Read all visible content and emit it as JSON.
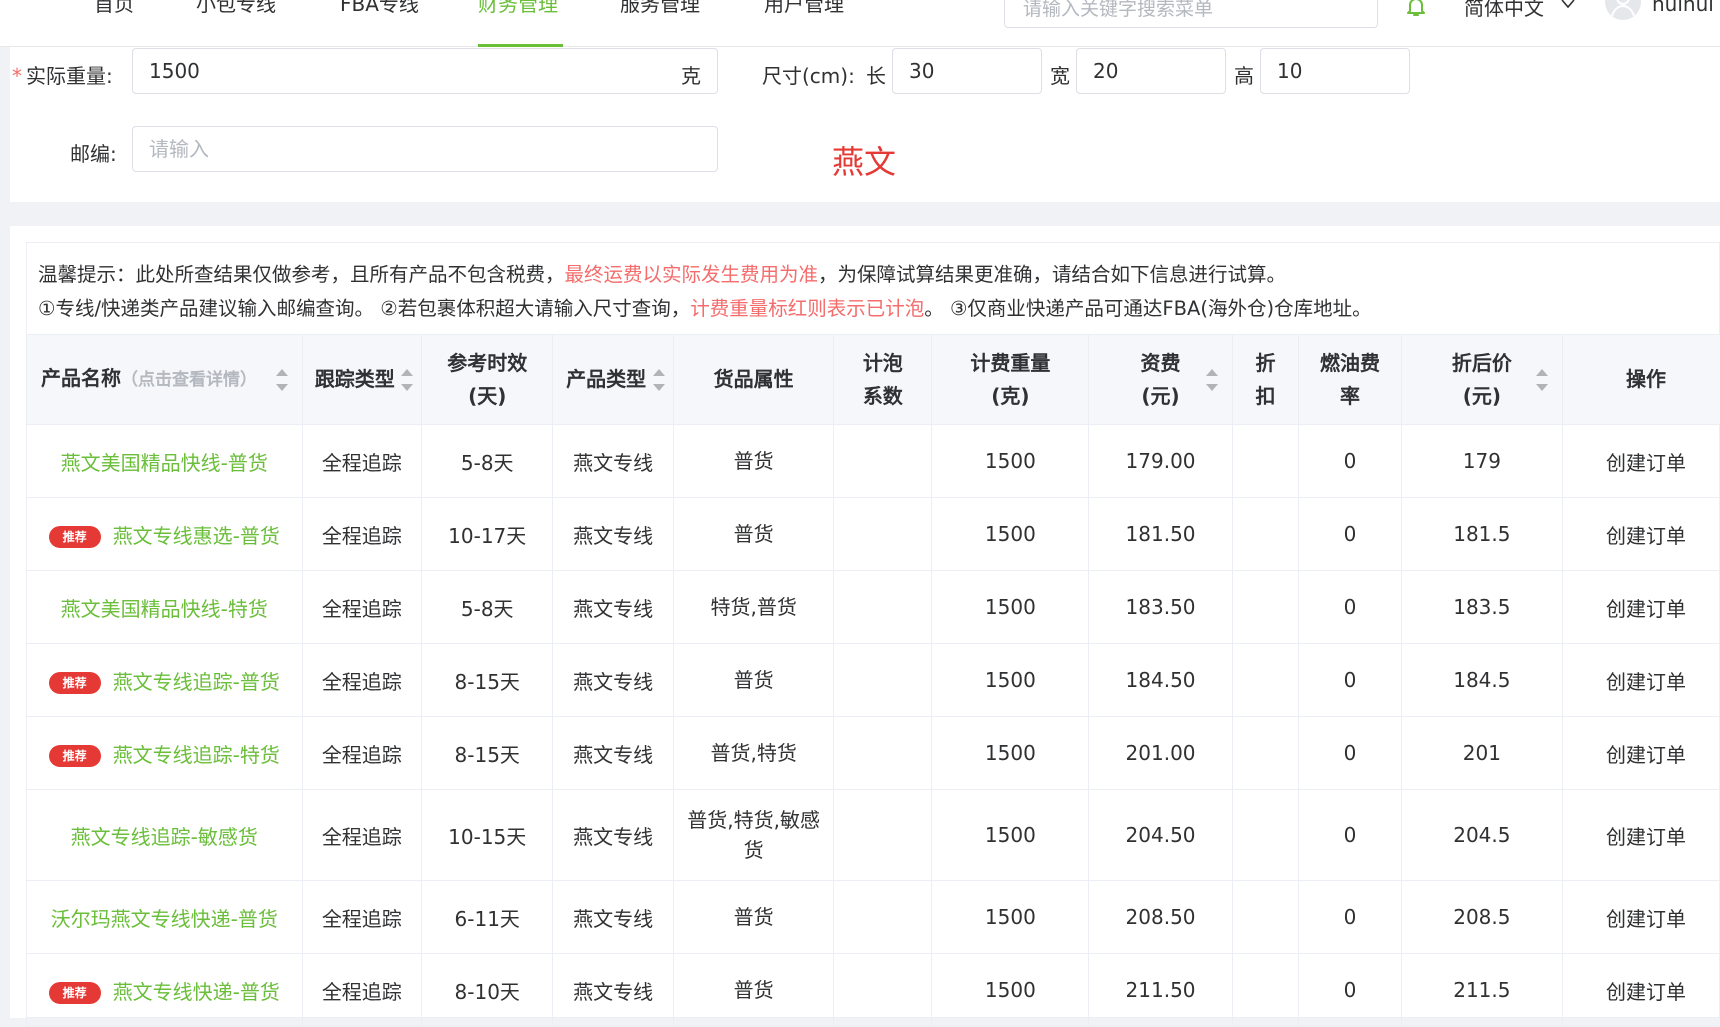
{
  "nav": {
    "items": [
      {
        "label": "首页",
        "active": false
      },
      {
        "label": "小包专线",
        "active": false
      },
      {
        "label": "FBA专线",
        "active": false
      },
      {
        "label": "财务管理",
        "active": true
      },
      {
        "label": "服务管理",
        "active": false
      },
      {
        "label": "用户管理",
        "active": false
      }
    ],
    "search_placeholder": "请输入关键字搜索菜单",
    "language": "简体中文",
    "username": "huihui"
  },
  "form": {
    "weight_label": "实际重量:",
    "weight_required_mark": "*",
    "weight_value": "1500",
    "weight_unit": "克",
    "size_label": "尺寸(cm):",
    "length_label": "长",
    "length_value": "30",
    "width_label": "宽",
    "width_value": "20",
    "height_label": "高",
    "height_value": "10",
    "zip_label": "邮编:",
    "zip_placeholder": "请输入",
    "carrier_name": "燕文"
  },
  "tips": {
    "line1_a": "温馨提示：此处所查结果仅做参考，且所有产品不包含税费，",
    "line1_b": "最终运费以实际发生费用为准",
    "line1_c": "，为保障试算结果更准确，请结合如下信息进行试算。",
    "line2_a": "①专线/快递类产品建议输入邮编查询。 ②若包裹体积超大请输入尺寸查询，",
    "line2_b": "计费重量标红则表示已计泡",
    "line2_c": "。 ③仅商业快递产品可通达FBA(海外仓)仓库地址。"
  },
  "table": {
    "headers": {
      "product_name": "产品名称",
      "product_hint": "（点击查看详情）",
      "tracking_type": "跟踪类型",
      "eta": "参考时效(天)",
      "product_type": "产品类型",
      "goods_attr": "货品属性",
      "vol_factor": "计泡系数",
      "billing_weight": "计费重量(克)",
      "fee": "资费(元)",
      "discount": "折扣",
      "fuel_rate": "燃油费率",
      "final_price": "折后价(元)",
      "operation": "操作"
    },
    "badge_label": "推荐",
    "rows": [
      {
        "name": "燕文美国精品快线-普货",
        "recommended": false,
        "tracking": "全程追踪",
        "eta": "5-8天",
        "type": "燕文专线",
        "attr": "普货",
        "vol": "",
        "weight": "1500",
        "fee": "179.00",
        "discount": "",
        "fuel": "0",
        "final": "179",
        "op": "创建订单"
      },
      {
        "name": "燕文专线惠选-普货",
        "recommended": true,
        "tracking": "全程追踪",
        "eta": "10-17天",
        "type": "燕文专线",
        "attr": "普货",
        "vol": "",
        "weight": "1500",
        "fee": "181.50",
        "discount": "",
        "fuel": "0",
        "final": "181.5",
        "op": "创建订单"
      },
      {
        "name": "燕文美国精品快线-特货",
        "recommended": false,
        "tracking": "全程追踪",
        "eta": "5-8天",
        "type": "燕文专线",
        "attr": "特货,普货",
        "vol": "",
        "weight": "1500",
        "fee": "183.50",
        "discount": "",
        "fuel": "0",
        "final": "183.5",
        "op": "创建订单"
      },
      {
        "name": "燕文专线追踪-普货",
        "recommended": true,
        "tracking": "全程追踪",
        "eta": "8-15天",
        "type": "燕文专线",
        "attr": "普货",
        "vol": "",
        "weight": "1500",
        "fee": "184.50",
        "discount": "",
        "fuel": "0",
        "final": "184.5",
        "op": "创建订单"
      },
      {
        "name": "燕文专线追踪-特货",
        "recommended": true,
        "tracking": "全程追踪",
        "eta": "8-15天",
        "type": "燕文专线",
        "attr": "普货,特货",
        "vol": "",
        "weight": "1500",
        "fee": "201.00",
        "discount": "",
        "fuel": "0",
        "final": "201",
        "op": "创建订单"
      },
      {
        "name": "燕文专线追踪-敏感货",
        "recommended": false,
        "tracking": "全程追踪",
        "eta": "10-15天",
        "type": "燕文专线",
        "attr": "普货,特货,敏感货",
        "vol": "",
        "weight": "1500",
        "fee": "204.50",
        "discount": "",
        "fuel": "0",
        "final": "204.5",
        "op": "创建订单"
      },
      {
        "name": "沃尔玛燕文专线快递-普货",
        "recommended": false,
        "tracking": "全程追踪",
        "eta": "6-11天",
        "type": "燕文专线",
        "attr": "普货",
        "vol": "",
        "weight": "1500",
        "fee": "208.50",
        "discount": "",
        "fuel": "0",
        "final": "208.5",
        "op": "创建订单"
      },
      {
        "name": "燕文专线快递-普货",
        "recommended": true,
        "tracking": "全程追踪",
        "eta": "8-10天",
        "type": "燕文专线",
        "attr": "普货",
        "vol": "",
        "weight": "1500",
        "fee": "211.50",
        "discount": "",
        "fuel": "0",
        "final": "211.5",
        "op": "创建订单"
      }
    ]
  },
  "colors": {
    "accent": "#6abe39",
    "danger": "#e53935",
    "required": "#f56c6c"
  },
  "icons": {
    "bell": "bell-icon",
    "chevron": "chevron-down-icon",
    "avatar": "user-avatar-icon",
    "sort": "sort-caret-icon"
  }
}
